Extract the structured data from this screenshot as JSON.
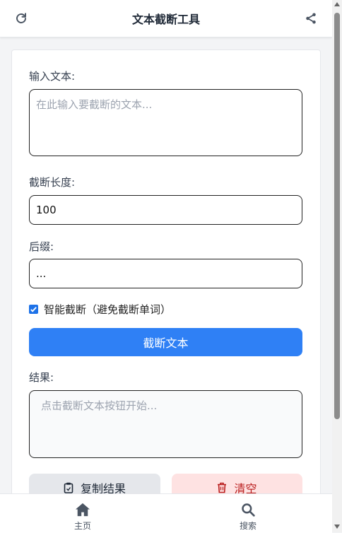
{
  "header": {
    "title": "文本截断工具",
    "refresh_icon": "refresh-icon",
    "share_icon": "share-icon"
  },
  "form": {
    "input_label": "输入文本:",
    "input_placeholder": "在此输入要截断的文本...",
    "length_label": "截断长度:",
    "length_value": "100",
    "suffix_label": "后缀:",
    "suffix_value": "...",
    "smart_label": "智能截断（避免截断单词）",
    "smart_checked": true,
    "submit_label": "截断文本",
    "result_label": "结果:",
    "result_placeholder": "点击截断文本按钮开始..."
  },
  "actions": {
    "copy_label": "复制结果",
    "copy_icon": "clipboard-icon",
    "clear_label": "清空",
    "clear_icon": "trash-icon"
  },
  "nav": {
    "home_label": "主页",
    "home_icon": "home-icon",
    "search_label": "搜索",
    "search_icon": "search-icon"
  },
  "colors": {
    "primary": "#2f80f5",
    "danger_bg": "#fee2e2",
    "danger_text": "#b91c1c",
    "secondary_bg": "#e5e7eb"
  }
}
